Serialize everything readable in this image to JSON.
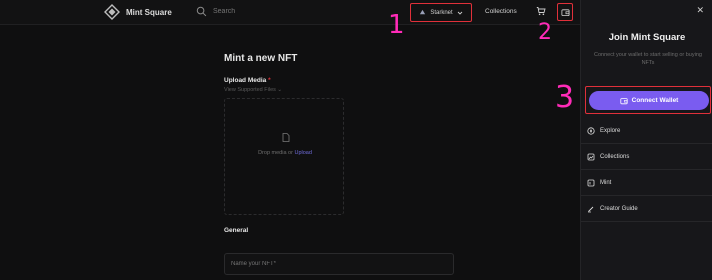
{
  "header": {
    "brand": "Mint Square",
    "search_placeholder": "Search",
    "network": "Starknet",
    "collections": "Collections"
  },
  "main": {
    "title": "Mint a new NFT",
    "upload_label": "Upload Media",
    "required_mark": "*",
    "supported_files": "View Supported Files ⌄",
    "drop_prefix": "Drop media or",
    "drop_link": "Upload",
    "general_label": "General",
    "name_placeholder": "Name your NFT*"
  },
  "annotations": [
    "1",
    "2",
    "3"
  ],
  "drawer": {
    "close": "✕",
    "title": "Join Mint Square",
    "subtitle": "Connect your wallet to start selling or buying NFTs",
    "connect_label": "Connect Wallet",
    "menu": [
      {
        "label": "Explore",
        "icon": "compass-icon"
      },
      {
        "label": "Collections",
        "icon": "collections-icon"
      },
      {
        "label": "Mint",
        "icon": "mint-icon"
      },
      {
        "label": "Creator Guide",
        "icon": "pen-icon"
      }
    ]
  },
  "colors": {
    "accent": "#7a5cf0",
    "annotation": "#ff2bb8",
    "highlight_box": "#e0303a"
  }
}
